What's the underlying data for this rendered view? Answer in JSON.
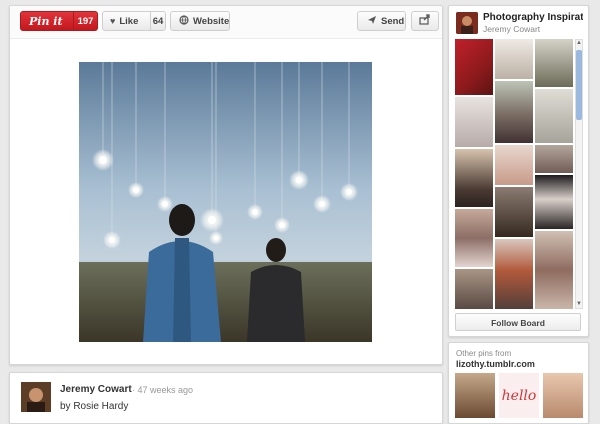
{
  "toolbar": {
    "pin_label": "Pin it",
    "pin_count": "197",
    "like_label": "Like",
    "like_count": "64",
    "website_label": "Website",
    "send_label": "Send"
  },
  "board": {
    "title": "Photography Inspirati...",
    "owner": "Jeremy Cowart",
    "follow_label": "Follow Board"
  },
  "other_pins": {
    "label": "Other pins from",
    "source": "lizothy.tumblr.com",
    "hello_text": "hello"
  },
  "comment": {
    "author": "Jeremy Cowart",
    "time": "· 47 weeks ago",
    "text": "by Rosie Hardy"
  },
  "colors": {
    "accent": "#c3181e",
    "scroll_thumb": "#9bb8de"
  },
  "icons": {
    "like": "heart-icon",
    "website": "globe-icon",
    "send": "paper-plane-icon",
    "share": "share-arrow-icon"
  }
}
